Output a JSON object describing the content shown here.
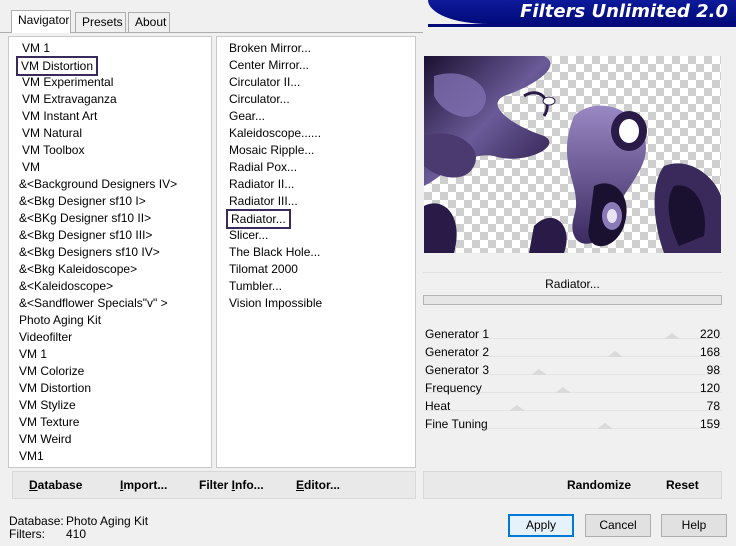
{
  "tabs": [
    {
      "label": "Navigator"
    },
    {
      "label": "Presets"
    },
    {
      "label": "About"
    }
  ],
  "header": {
    "title": "Filters Unlimited 2.0"
  },
  "categories": [
    "VM 1",
    "VM Distortion",
    "VM Experimental",
    "VM Extravaganza",
    "VM Instant Art",
    "VM Natural",
    "VM Toolbox",
    "VM",
    "&<Background Designers IV>",
    "&<Bkg Designer sf10 I>",
    "&<BKg Designer sf10 II>",
    "&<Bkg Designer sf10 III>",
    "&<Bkg Designers sf10 IV>",
    "&<Bkg Kaleidoscope>",
    "&<Kaleidoscope>",
    "&<Sandflower Specials\"v\" >",
    "Photo Aging Kit",
    "Videofilter",
    "VM 1",
    "VM Colorize",
    "VM Distortion",
    "VM Stylize",
    "VM Texture",
    "VM Weird",
    "VM1"
  ],
  "filters": [
    "Broken Mirror...",
    "Center Mirror...",
    "Circulator II...",
    "Circulator...",
    "Gear...",
    "Kaleidoscope......",
    "Mosaic Ripple...",
    "Radial Pox...",
    "Radiator II...",
    "Radiator III...",
    "Radiator...",
    "Slicer...",
    "The Black Hole...",
    "Tilomat 2000",
    "Tumbler...",
    "Vision Impossible"
  ],
  "selected": {
    "category_index": 1,
    "filter_index": 10
  },
  "preview": {
    "filter_name": "Radiator..."
  },
  "params": [
    {
      "label": "Generator 1",
      "value": 220,
      "max": 255
    },
    {
      "label": "Generator 2",
      "value": 168,
      "max": 255
    },
    {
      "label": "Generator 3",
      "value": 98,
      "max": 255
    },
    {
      "label": "Frequency",
      "value": 120,
      "max": 255
    },
    {
      "label": "Heat",
      "value": 78,
      "max": 255
    },
    {
      "label": "Fine Tuning",
      "value": 159,
      "max": 255
    }
  ],
  "left_buttons": {
    "database": {
      "ul": "D",
      "rest": "atabase"
    },
    "import": {
      "ul": "I",
      "rest": "mport..."
    },
    "filter_info": {
      "pre": "Filter ",
      "ul": "I",
      "rest": "nfo..."
    },
    "editor": {
      "ul": "E",
      "rest": "ditor..."
    }
  },
  "right_buttons": {
    "randomize": "Randomize",
    "reset": "Reset"
  },
  "status": {
    "database_label": "Database:",
    "database_value": "Photo Aging Kit",
    "filters_label": "Filters:",
    "filters_value": "410"
  },
  "dialog_buttons": {
    "apply": "Apply",
    "cancel": "Cancel",
    "help": "Help"
  }
}
